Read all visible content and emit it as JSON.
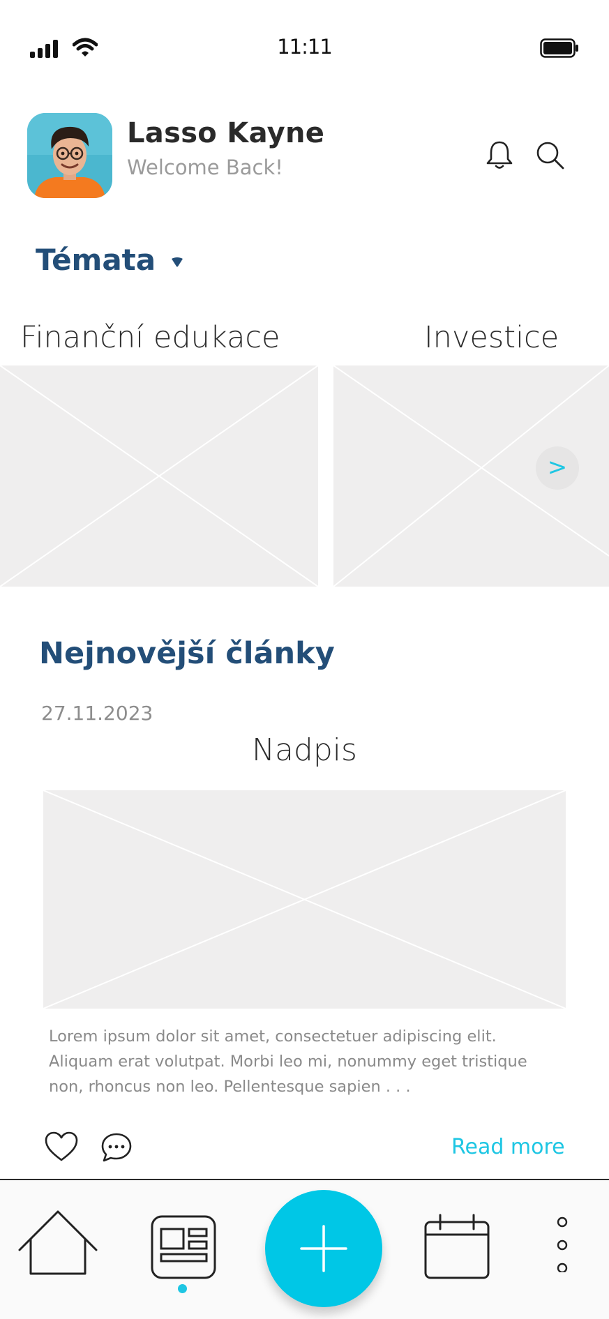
{
  "status_bar": {
    "time": "11:11"
  },
  "header": {
    "user_name": "Lasso Kayne",
    "greeting": "Welcome Back!"
  },
  "topics": {
    "title": "Témata",
    "items": [
      {
        "label": "Finanční edukace"
      },
      {
        "label": "Investice"
      }
    ]
  },
  "articles": {
    "title": "Nejnovější články",
    "items": [
      {
        "date": "27.11.2023",
        "title": "Nadpis",
        "excerpt": "Lorem ipsum dolor sit amet, consectetuer adipiscing elit. Aliquam erat volutpat. Morbi leo mi, nonummy eget tristique non, rhoncus non leo. Pellentesque sapien . . .",
        "read_more": "Read more"
      }
    ]
  },
  "colors": {
    "accent": "#00c7e6",
    "heading": "#234e78",
    "placeholder": "#efeeee"
  },
  "icons": {
    "status": [
      "signal-icon",
      "wifi-icon",
      "battery-icon"
    ],
    "header": [
      "bell-icon",
      "search-icon"
    ],
    "nav": [
      "home-icon",
      "news-icon",
      "add-icon",
      "calendar-icon",
      "more-icon"
    ]
  },
  "nav": {
    "active_index": 1
  }
}
